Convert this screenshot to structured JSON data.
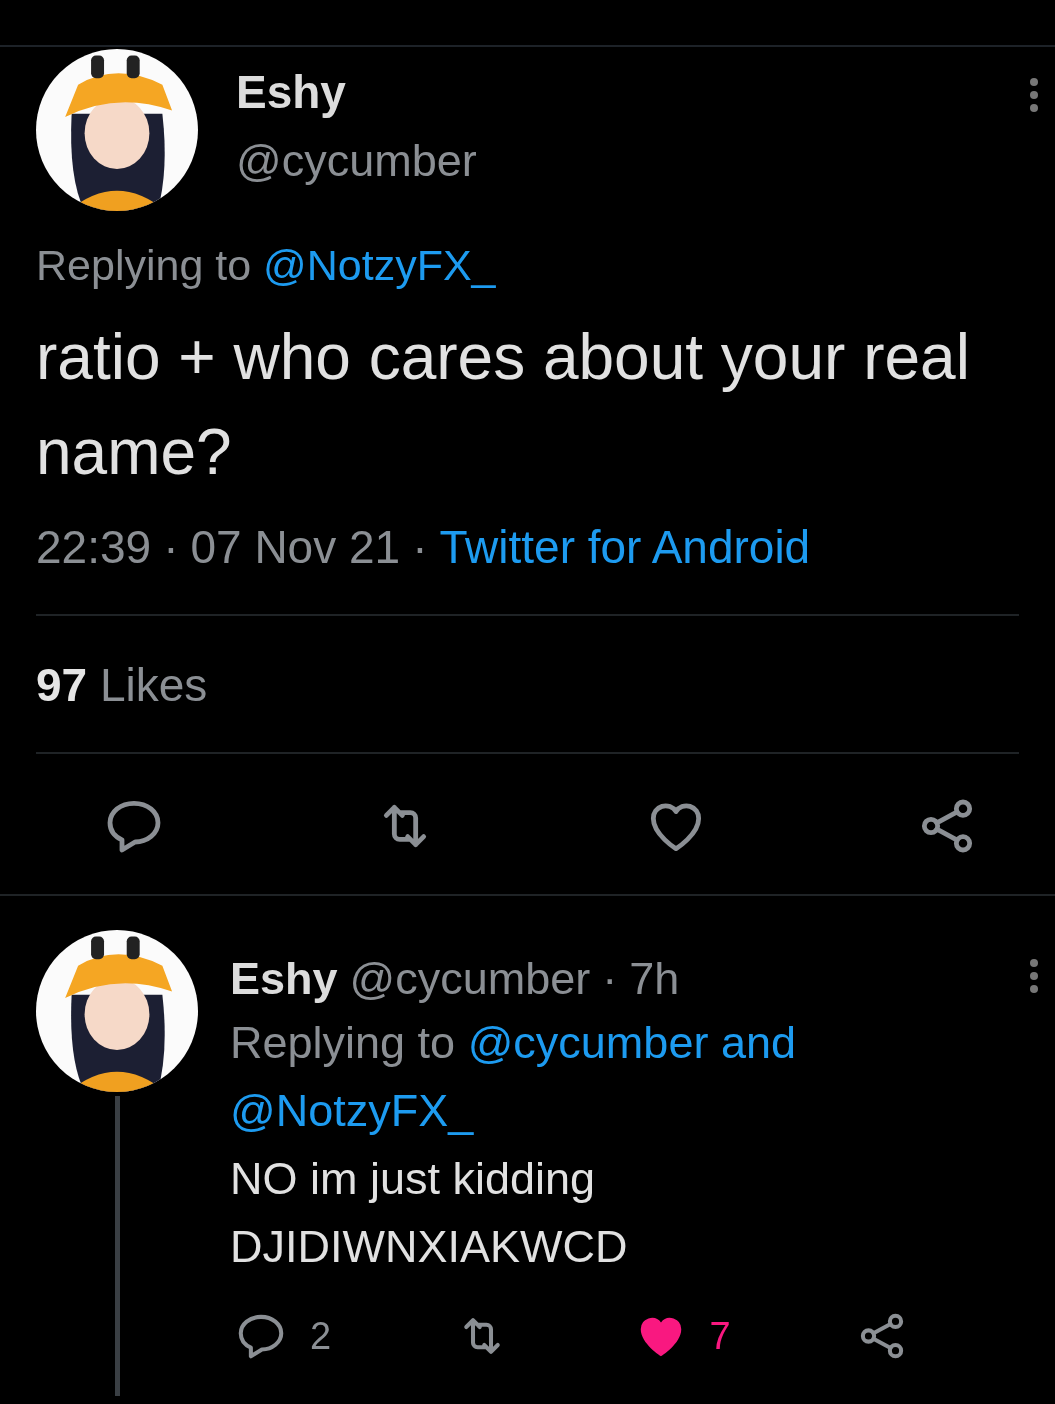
{
  "tweet": {
    "name": "Eshy",
    "handle": "@cycumber",
    "replying_prefix": "Replying to",
    "replying_to": "@NotzyFX_",
    "text": "ratio + who cares about your real name?",
    "time": "22:39",
    "separator": "·",
    "date": "07 Nov 21",
    "source": "Twitter for Android",
    "likes_count": "97",
    "likes_label": "Likes",
    "actions": [
      {
        "kind": "reply"
      },
      {
        "kind": "retweet"
      },
      {
        "kind": "like",
        "liked": false
      },
      {
        "kind": "share"
      }
    ]
  },
  "reply": {
    "name": "Eshy",
    "handle": "@cycumber",
    "separator": "·",
    "age": "7h",
    "replying_prefix": "Replying to",
    "replying_to": [
      "@cycumber and",
      "@NotzyFX_"
    ],
    "text": "NO im just kidding\nDJIDIWNXIAKWCD",
    "actions": [
      {
        "kind": "reply",
        "count": "2"
      },
      {
        "kind": "retweet"
      },
      {
        "kind": "like",
        "liked": true,
        "count": "7"
      },
      {
        "kind": "share"
      }
    ]
  }
}
